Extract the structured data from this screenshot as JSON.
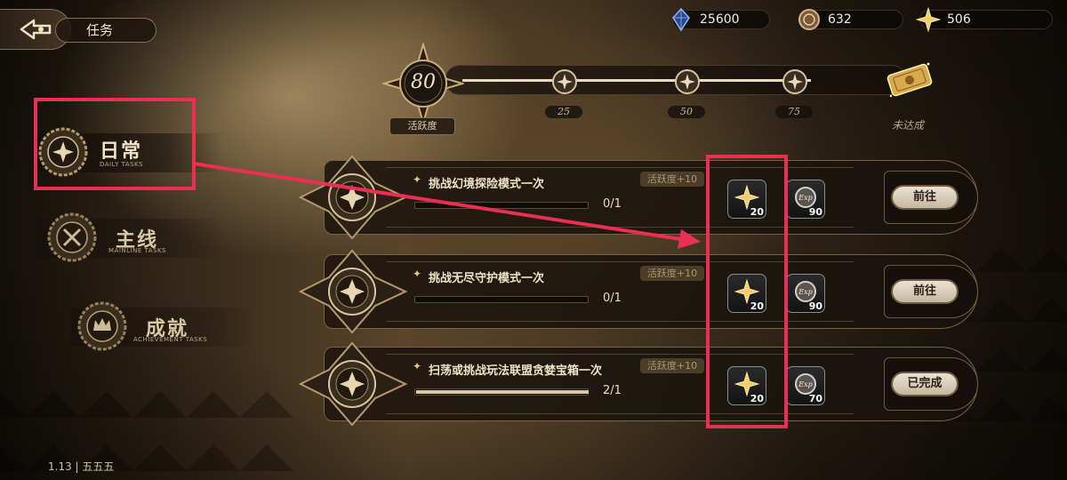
{
  "header": {
    "title": "任务"
  },
  "resources": [
    {
      "name": "crystal",
      "value": "25600",
      "icon": "blue-crystal-icon"
    },
    {
      "name": "coin",
      "value": "632",
      "icon": "bronze-coin-icon"
    },
    {
      "name": "star",
      "value": "506",
      "icon": "gold-star-icon"
    }
  ],
  "activity": {
    "current": "80",
    "label": "活跃度",
    "progress": 0.8,
    "milestones": [
      "25",
      "50",
      "75"
    ],
    "chest_status": "未达成"
  },
  "nav": {
    "tabs": [
      {
        "label": "日常",
        "sub": "DAILY TASKS",
        "selected": true
      },
      {
        "label": "主线",
        "sub": "MAINLINE TASKS",
        "selected": false
      },
      {
        "label": "成就",
        "sub": "ACHIEVEMENT TASKS",
        "selected": false
      }
    ]
  },
  "tasks": [
    {
      "title": "挑战幻境探险模式一次",
      "activity_tag": "活跃度+10",
      "progress": "0/1",
      "fill": 0.0,
      "rewards": [
        {
          "icon": "gold-star-icon",
          "value": "20"
        },
        {
          "icon": "exp-icon",
          "value": "90"
        }
      ],
      "button": "前往"
    },
    {
      "title": "挑战无尽守护模式一次",
      "activity_tag": "活跃度+10",
      "progress": "0/1",
      "fill": 0.0,
      "rewards": [
        {
          "icon": "gold-star-icon",
          "value": "20"
        },
        {
          "icon": "exp-icon",
          "value": "90"
        }
      ],
      "button": "前往"
    },
    {
      "title": "扫荡或挑战玩法联盟贪婪宝箱一次",
      "activity_tag": "活跃度+10",
      "progress": "2/1",
      "fill": 1.0,
      "rewards": [
        {
          "icon": "gold-star-icon",
          "value": "20"
        },
        {
          "icon": "exp-icon",
          "value": "70"
        }
      ],
      "button": "已完成"
    }
  ],
  "version": "1.13 | 五五五",
  "colors": {
    "highlight": "#ea2f52",
    "gold": "#e9c46a",
    "panel": "#1e170f"
  }
}
